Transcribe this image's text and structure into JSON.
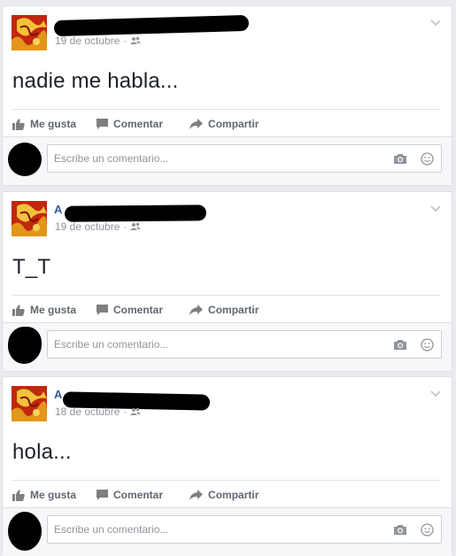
{
  "actions": {
    "like_label": "Me gusta",
    "comment_label": "Comentar",
    "share_label": "Compartir"
  },
  "comment_placeholder": "Escribe un comentario...",
  "posts": [
    {
      "author_visible": "",
      "date": "19 de octubre",
      "audience_icon": "friends-icon",
      "text": "nadie me habla..."
    },
    {
      "author_visible": "A",
      "date": "19 de octubre",
      "audience_icon": "friends-icon",
      "text": "T_T"
    },
    {
      "author_visible": "A",
      "date": "18 de octubre",
      "audience_icon": "friends-icon",
      "text": "hola..."
    }
  ],
  "colors": {
    "page_background": "#e9ebee",
    "card_background": "#ffffff",
    "meta_text": "#90949c",
    "action_text": "#606770",
    "author_link": "#365899"
  }
}
